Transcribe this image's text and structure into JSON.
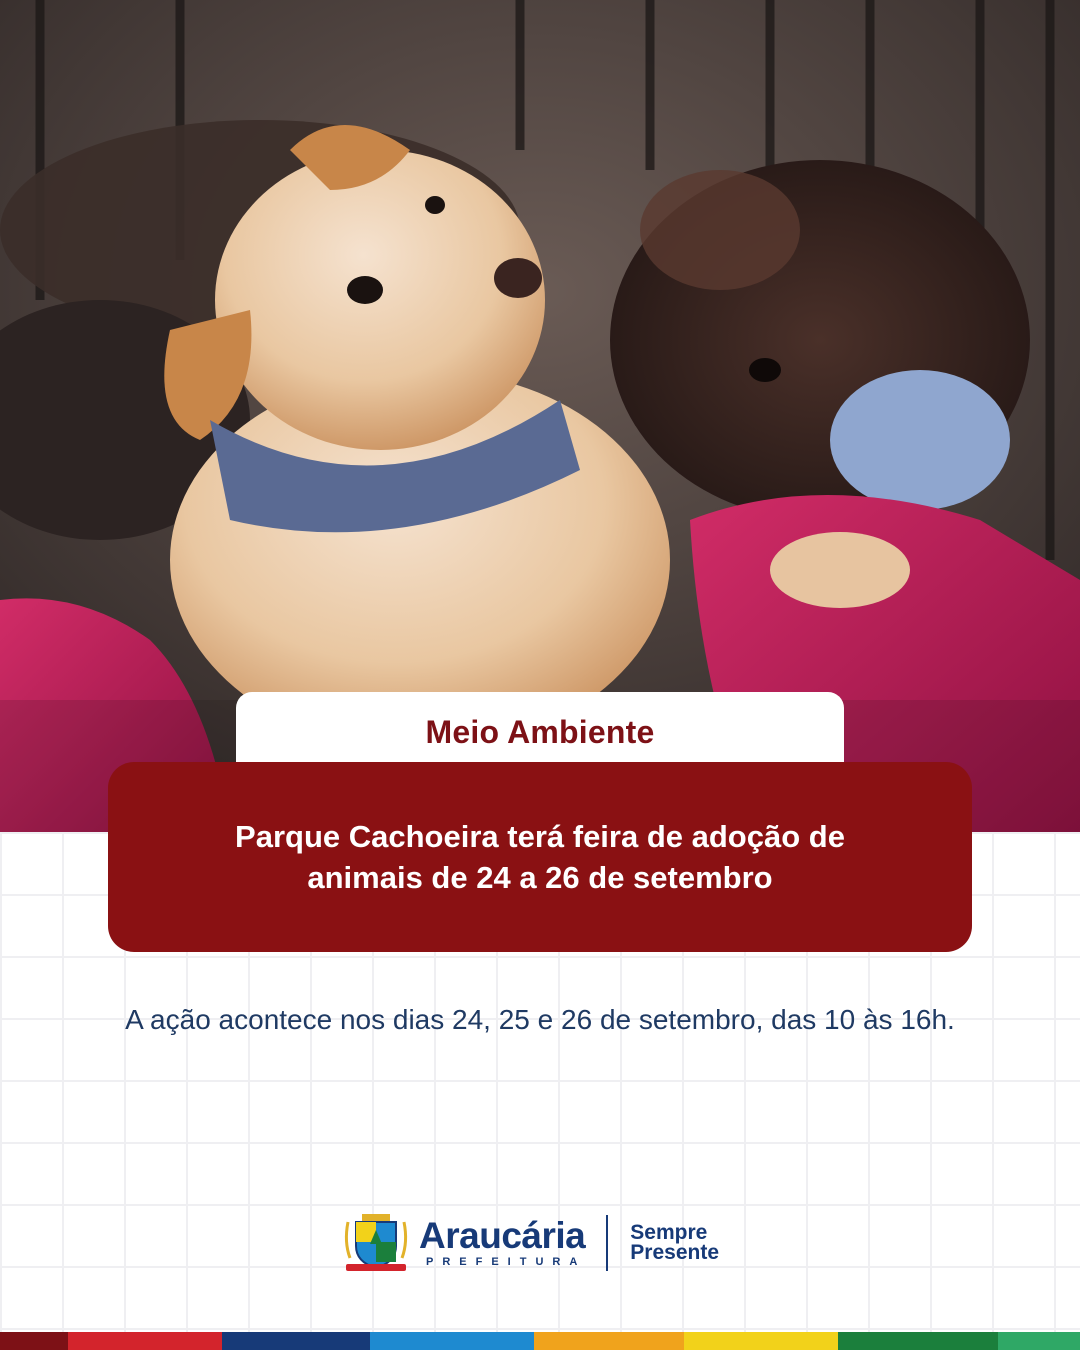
{
  "photo": {
    "description_icon": "puppies-photo"
  },
  "category": {
    "label": "Meio Ambiente"
  },
  "headline": {
    "line1": "Parque Cachoeira terá feira de adoção de",
    "line2": "animais de 24 a 26 de setembro"
  },
  "body": {
    "text": "A ação acontece nos dias 24, 25 e 26 de setembro, das 10 às 16h."
  },
  "footer": {
    "brand_name": "Araucária",
    "brand_sub": "PREFEITURA",
    "slogan_line1": "Sempre",
    "slogan_line2": "Presente"
  },
  "colors": {
    "primary_red": "#8a1113",
    "navy": "#173a78",
    "stripe": [
      "#7d1116",
      "#d3242c",
      "#173a78",
      "#1e8ad0",
      "#f0a31c",
      "#f2d21a",
      "#1b7f3c",
      "#2fa866"
    ]
  }
}
